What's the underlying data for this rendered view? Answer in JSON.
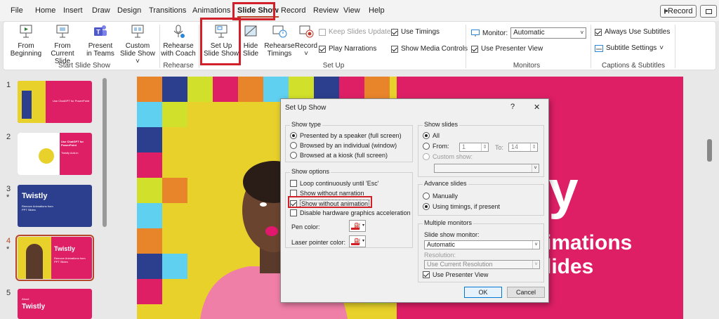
{
  "tabs": [
    "File",
    "Home",
    "Insert",
    "Draw",
    "Design",
    "Transitions",
    "Animations",
    "Slide Show",
    "Record",
    "Review",
    "View",
    "Help"
  ],
  "record_button": "Record",
  "ribbon": {
    "from_beginning": "From Beginning",
    "from_current": "From Current Slide",
    "present_teams": "Present in Teams",
    "custom_show": "Custom Slide Show",
    "group_start": "Start Slide Show",
    "rehearse_coach": "Rehearse with Coach",
    "group_rehearse": "Rehearse",
    "setup_show": "Set Up Slide Show",
    "hide_slide": "Hide Slide",
    "rehearse_timings": "Rehearse Timings",
    "record": "Record",
    "keep_updated": "Keep Slides Updated",
    "play_narrations": "Play Narrations",
    "use_timings": "Use Timings",
    "show_media": "Show Media Controls",
    "group_setup": "Set Up",
    "monitor_label": "Monitor:",
    "monitor_value": "Automatic",
    "presenter_view": "Use Presenter View",
    "group_monitors": "Monitors",
    "always_subtitles": "Always Use Subtitles",
    "subtitle_settings": "Subtitle Settings",
    "group_captions": "Captions & Subtitles"
  },
  "slides": [
    {
      "num": "1",
      "star": "",
      "title": "",
      "subtitle": "Use ChatGPT for PowerPoint"
    },
    {
      "num": "2",
      "star": "",
      "title": "Use ChatGPT for PowerPoint",
      "subtitle": "Twistly Add-in"
    },
    {
      "num": "3",
      "star": "*",
      "title": "Twistly",
      "subtitle": "Remove Animations from PPT Slides"
    },
    {
      "num": "4",
      "star": "*",
      "title": "Twistly",
      "subtitle": "Remove Animations from PPT Slides"
    },
    {
      "num": "5",
      "star": "",
      "title": "Twistly",
      "subtitle": "About"
    }
  ],
  "slide": {
    "title_partial": "tly",
    "line1": "imations",
    "line2": "lides"
  },
  "dialog": {
    "title": "Set Up Show",
    "help": "?",
    "close": "✕",
    "show_type": "Show type",
    "type_options": [
      "Presented by a speaker (full screen)",
      "Browsed by an individual (window)",
      "Browsed at a kiosk (full screen)"
    ],
    "show_options": "Show options",
    "loop": "Loop continuously until 'Esc'",
    "no_narration": "Show without narration",
    "no_animation": "Show without animation",
    "disable_hw": "Disable hardware graphics acceleration",
    "pen_color": "Pen color:",
    "laser_color": "Laser pointer color:",
    "show_slides": "Show slides",
    "all": "All",
    "from": "From:",
    "from_value": "1",
    "to": "To:",
    "to_value": "14",
    "custom_show": "Custom show:",
    "advance": "Advance slides",
    "manually": "Manually",
    "using_timings": "Using timings, if present",
    "multiple_monitors": "Multiple monitors",
    "slideshow_monitor": "Slide show monitor:",
    "monitor_value": "Automatic",
    "resolution": "Resolution:",
    "resolution_value": "Use Current Resolution",
    "presenter_view": "Use Presenter View",
    "ok": "OK",
    "cancel": "Cancel"
  },
  "colors": {
    "accent": "#b7472a",
    "highlight": "#d1202a",
    "slide_bg": "#de1f66",
    "slide_yellow": "#e8d12a",
    "slide_navy": "#2b3f8e"
  }
}
